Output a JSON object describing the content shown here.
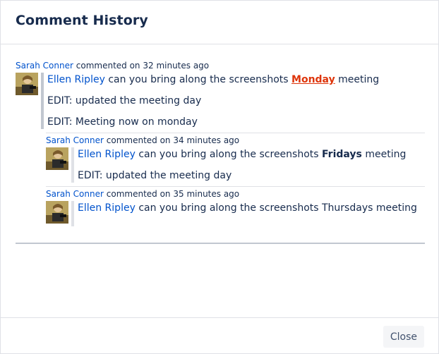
{
  "dialog": {
    "title": "Comment History",
    "close_label": "Close"
  },
  "comments": [
    {
      "author": "Sarah Conner",
      "meta_text": "commented on 32 minutes ago",
      "mention": "Ellen Ripley",
      "text_before": "can you bring along the screenshots",
      "emphasis": "Monday",
      "text_after": "meeting",
      "edits": [
        "EDIT: updated the meeting day",
        "EDIT: Meeting now on monday"
      ]
    },
    {
      "author": "Sarah Conner",
      "meta_text": "commented on 34 minutes ago",
      "mention": "Ellen Ripley",
      "text_before": "can you bring along the screenshots",
      "emphasis": "Fridays",
      "text_after": "meeting",
      "edits": [
        "EDIT: updated the meeting day"
      ]
    },
    {
      "author": "Sarah Conner",
      "meta_text": "commented on 35 minutes ago",
      "mention": "Ellen Ripley",
      "text": "can you bring along the screenshots Thursdays meeting"
    }
  ]
}
